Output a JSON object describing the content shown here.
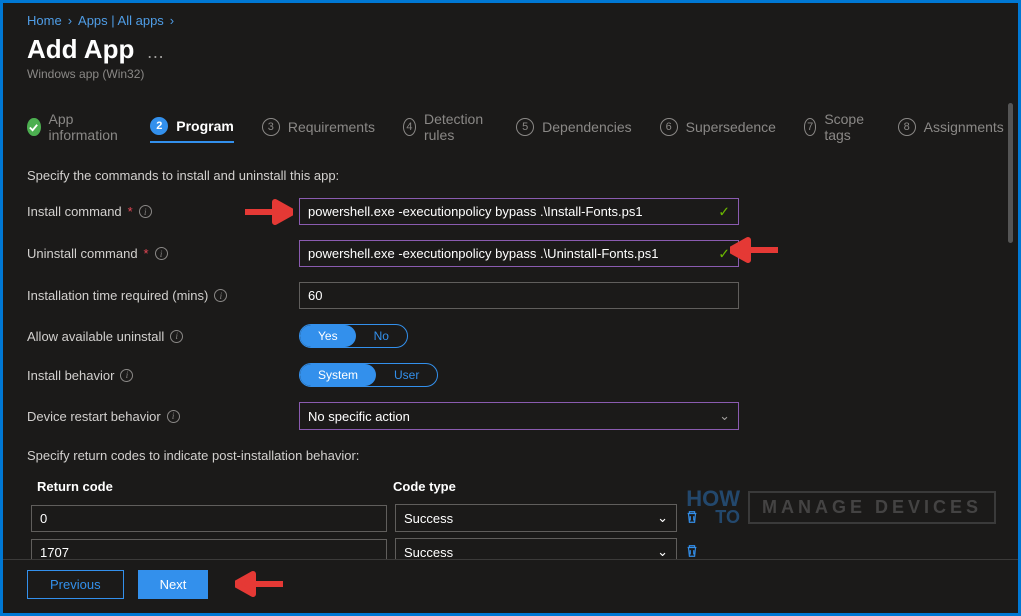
{
  "breadcrumb": {
    "home": "Home",
    "apps": "Apps | All apps"
  },
  "header": {
    "title": "Add App",
    "subtitle": "Windows app (Win32)"
  },
  "tabs": {
    "t1": "App information",
    "t2": "Program",
    "t3": "Requirements",
    "t4": "Detection rules",
    "t5": "Dependencies",
    "t6": "Supersedence",
    "t7": "Scope tags",
    "t8": "Assignments"
  },
  "sectionCmds": "Specify the commands to install and uninstall this app:",
  "labels": {
    "install": "Install command",
    "uninstall": "Uninstall command",
    "time": "Installation time required (mins)",
    "allow": "Allow available uninstall",
    "behavior": "Install behavior",
    "restart": "Device restart behavior"
  },
  "values": {
    "install": "powershell.exe -executionpolicy bypass .\\Install-Fonts.ps1",
    "uninstall": "powershell.exe -executionpolicy bypass .\\Uninstall-Fonts.ps1",
    "time": "60",
    "restart": "No specific action"
  },
  "toggles": {
    "yes": "Yes",
    "no": "No",
    "system": "System",
    "user": "User"
  },
  "sectionReturn": "Specify return codes to indicate post-installation behavior:",
  "table": {
    "h1": "Return code",
    "h2": "Code type",
    "rows": [
      {
        "code": "0",
        "type": "Success"
      },
      {
        "code": "1707",
        "type": "Success"
      }
    ]
  },
  "footer": {
    "prev": "Previous",
    "next": "Next"
  },
  "watermark": {
    "how": "HOW",
    "to": "TO",
    "text": "MANAGE DEVICES"
  }
}
